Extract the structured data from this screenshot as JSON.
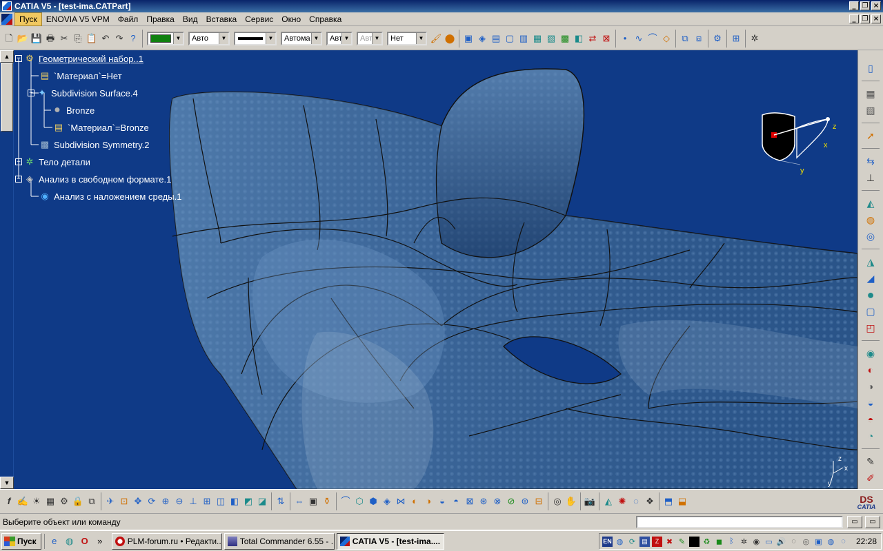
{
  "window": {
    "title": "CATIA V5 - [test-ima.CATPart]"
  },
  "menu": {
    "items": [
      "Пуск",
      "ENOVIA V5 VPM",
      "Файл",
      "Правка",
      "Вид",
      "Вставка",
      "Сервис",
      "Окно",
      "Справка"
    ],
    "active": "Пуск"
  },
  "toolbar": {
    "fill_color": "#108010",
    "color_mode": "Авто",
    "line_type_label": "Автома",
    "line_weight_label": "Авт",
    "point_label": "Авт",
    "layer": "Нет"
  },
  "tree": {
    "items": [
      {
        "label": "Геометрический набор..1",
        "icon": "geometric-set-icon"
      },
      {
        "label": "`Материал`=Нет",
        "icon": "material-icon"
      },
      {
        "label": "Subdivision Surface.4",
        "icon": "subdivision-surface-icon"
      },
      {
        "label": "Bronze",
        "icon": "bronze-sphere-icon"
      },
      {
        "label": "`Материал`=Bronze",
        "icon": "material-icon"
      },
      {
        "label": "Subdivision Symmetry.2",
        "icon": "symmetry-icon"
      },
      {
        "label": "Тело детали",
        "icon": "part-body-icon"
      },
      {
        "label": "Анализ в свободном формате.1",
        "icon": "freestyle-analysis-icon"
      },
      {
        "label": "Анализ с наложением среды.1",
        "icon": "environment-mapping-icon"
      }
    ]
  },
  "compass": {
    "x": "x",
    "y": "y",
    "z": "z"
  },
  "axis_indicator": {
    "x": "x",
    "y": "y",
    "z": "z"
  },
  "logo": {
    "brand": "CATIA",
    "mark": "DS"
  },
  "status": {
    "message": "Выберите объект или команду"
  },
  "taskbar": {
    "start": "Пуск",
    "tasks": [
      {
        "label": "PLM-forum.ru • Редакти...",
        "icon": "opera-icon"
      },
      {
        "label": "Total Commander 6.55 - ...",
        "icon": "total-commander-icon"
      },
      {
        "label": "CATIA V5 - [test-ima....",
        "icon": "catia-icon",
        "active": true
      }
    ],
    "lang": "EN",
    "clock": "22:28"
  }
}
